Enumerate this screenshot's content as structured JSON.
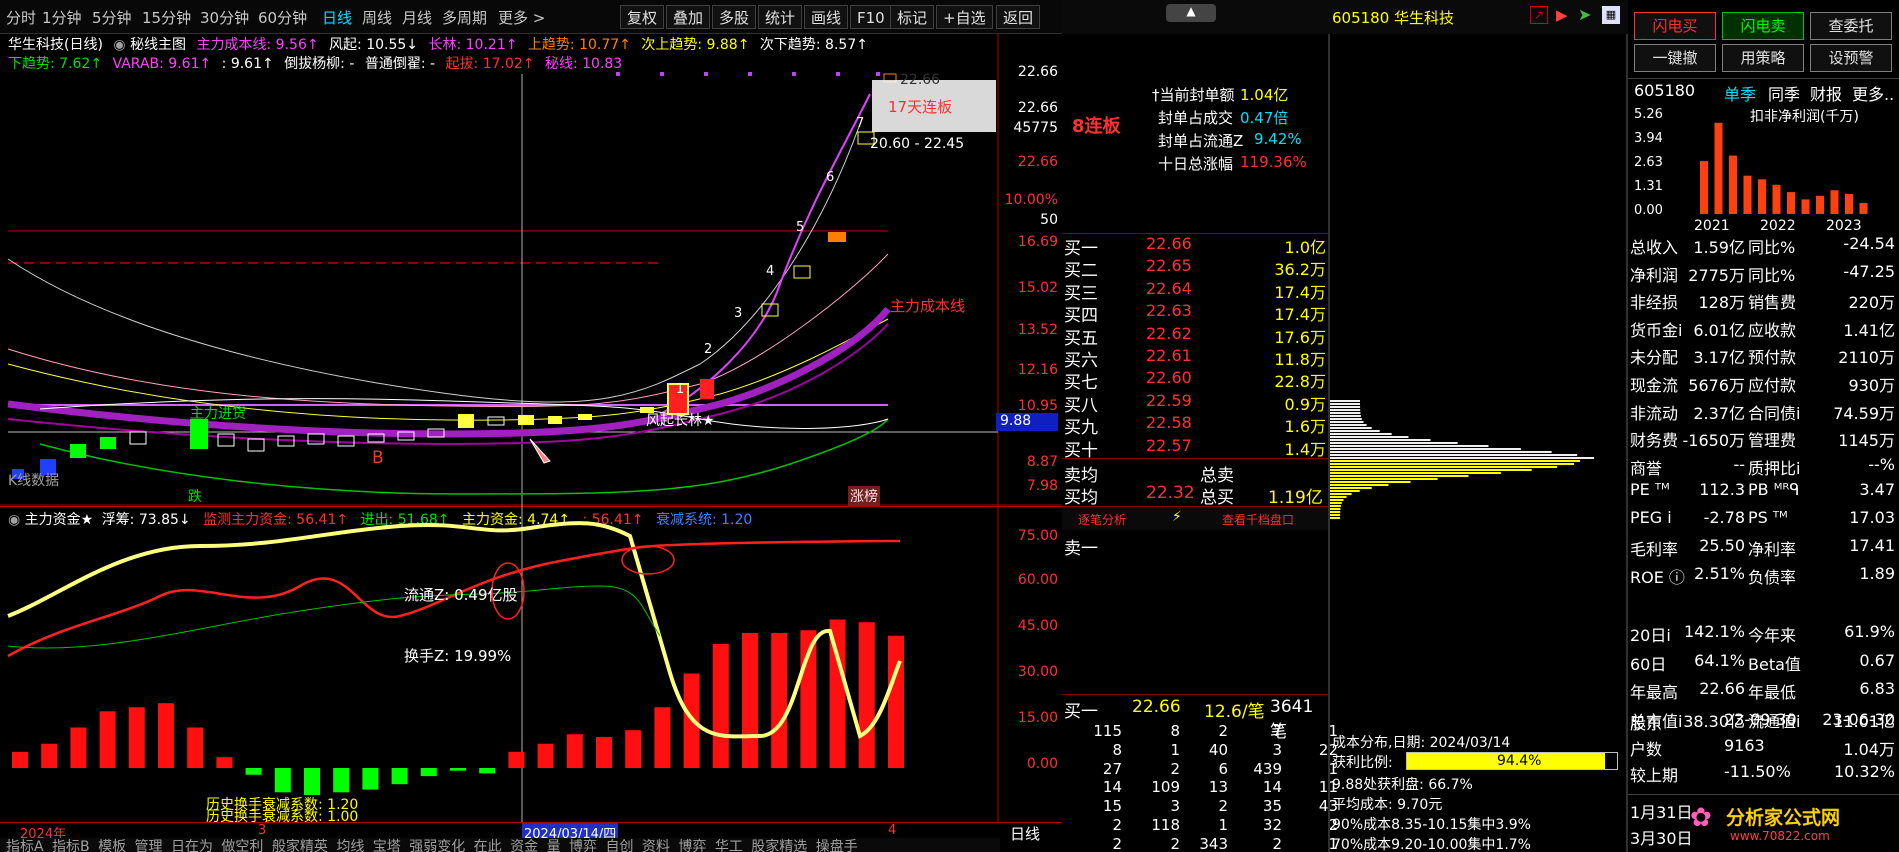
{
  "period_tabs": [
    "分时",
    "1分钟",
    "5分钟",
    "15分钟",
    "30分钟",
    "60分钟",
    "日线",
    "周线",
    "月线",
    "多周期",
    "更多 >"
  ],
  "toolbar": [
    "复权",
    "叠加",
    "多股",
    "统计",
    "画线",
    "F10",
    "标记",
    "+自选",
    "返回"
  ],
  "chart_title": {
    "name": "华生科技(日线)",
    "main": "秘线主图",
    "zlcbx": "主力成本线: 9.56↑",
    "fengqi": "风起: 10.55↓",
    "changlin": "长林: 10.21↑",
    "shangqs": "上趋势: 10.77↑",
    "ciqs": "次上趋势: 9.88↑",
    "cixqs": "次下趋势: 8.57↑"
  },
  "chart_title2": {
    "xqs": "下趋势: 7.62↑",
    "varab": "VARAB: 9.61↑",
    "v2": ": 9.61↑",
    "daobei": "倒拔杨柳: -",
    "putong": "普通倒翟: -",
    "qiba": "起拔: 17.02↑",
    "milin": "秘线: 10.83"
  },
  "price_axis": [
    "22.66",
    "45775",
    "22.66",
    "10.00%",
    "50",
    "16.69",
    "15.02",
    "13.52",
    "12.16",
    "10.95",
    "9.88",
    "8.87",
    "7.98"
  ],
  "annot": {
    "lianban": "17天连板",
    "range": "20.60 - 22.45",
    "zlcbx": "主力成本线",
    "zlcx": "主力进货",
    "fqcl": "风起长林★",
    "B": "B",
    "die": "跌",
    "zhangbang": "涨榜",
    "xdata": "K线数据",
    "c1": "1",
    "c2": "2",
    "c3": "3",
    "c4": "4",
    "c5": "5",
    "c6": "6",
    "c7": "7",
    "p1": "22.66"
  },
  "sub_title": {
    "name": "主力资金★",
    "fuchou": "浮筹: 73.85↓",
    "jiance": "监测主力资金: 56.41↑",
    "jinchu": "进出: 51.68↑",
    "zlzj": "主力资金: 4.74↑",
    "v2": ": 56.41↑",
    "sjxt": "衰减系统: 1.20"
  },
  "sub_axis": [
    "75.00",
    "60.00",
    "45.00",
    "30.00",
    "15.00",
    "0.00"
  ],
  "sub_annot": {
    "liutong": "流通Z: 0.49亿股",
    "huanshou": "换手Z: 19.99%",
    "hist1": "历史换手衰减系数: 1.20",
    "hist2": "历史换手衰减系数: 1.00"
  },
  "date_axis": {
    "d1": "2024年",
    "d2": "3",
    "d3": "2024/03/14/四",
    "d4": "4",
    "period": "日线"
  },
  "bottom_tabs": [
    "指标A",
    "指标B",
    "模板",
    "管理",
    "日在为",
    "做空利",
    "般家精英",
    "均线",
    "宝塔",
    "强弱变化",
    "在此",
    "资金",
    "量",
    "博弈",
    "自创",
    "资料",
    "博弈",
    "华工",
    "股家精选",
    "操盘手"
  ],
  "seal": {
    "title": "8连板",
    "r1l": "当前封单额",
    "r1v": "1.04亿",
    "r2l": "封单占成交",
    "r2v": "0.47倍",
    "r3l": "封单占流通Z",
    "r3v": "9.42%",
    "r4l": "十日总涨幅",
    "r4v": "119.36%"
  },
  "bids": [
    [
      "买一",
      "22.66",
      "1.0亿"
    ],
    [
      "买二",
      "22.65",
      "36.2万"
    ],
    [
      "买三",
      "22.64",
      "17.4万"
    ],
    [
      "买四",
      "22.63",
      "17.4万"
    ],
    [
      "买五",
      "22.62",
      "17.6万"
    ],
    [
      "买六",
      "22.61",
      "11.8万"
    ],
    [
      "买七",
      "22.60",
      "22.8万"
    ],
    [
      "买八",
      "22.59",
      "0.9万"
    ],
    [
      "买九",
      "22.58",
      "1.6万"
    ],
    [
      "买十",
      "22.57",
      "1.4万"
    ]
  ],
  "avg": {
    "maijun": "卖均",
    "zongmai": "总卖",
    "maijun2": "买均",
    "mjv": "22.32",
    "zongmai2": "总买",
    "zmv": "1.19亿"
  },
  "subtabs": {
    "a": "逐笔分析",
    "b": "⚡",
    "c": "查看千档盘口"
  },
  "sell1": "卖一",
  "trade_head": {
    "l": "买一",
    "p": "22.66",
    "v": "12.6/笔",
    "n": "3641笔"
  },
  "trades": [
    [
      "115",
      "8",
      "2",
      "7",
      "1"
    ],
    [
      "8",
      "1",
      "40",
      "3",
      "22"
    ],
    [
      "27",
      "2",
      "6",
      "439",
      "1"
    ],
    [
      "14",
      "109",
      "13",
      "14",
      "11"
    ],
    [
      "15",
      "3",
      "2",
      "35",
      "43"
    ],
    [
      "2",
      "118",
      "1",
      "32",
      "2"
    ],
    [
      "2",
      "2",
      "343",
      "2",
      "1"
    ]
  ],
  "stock_top": {
    "code_name": "605180 华生科技"
  },
  "cost": {
    "title": "成本分布,日期: 2024/03/14",
    "ratio_l": "获利比例:",
    "ratio_v": "94.4%",
    "l1": "9.88处获利盘: 66.7%",
    "l2": "平均成本: 9.70元",
    "l3": "90%成本8.35-10.15集中3.9%",
    "l4": "70%成本9.20-10.00集中1.7%",
    "price": "9.88"
  },
  "buttons": [
    "闪电买",
    "闪电卖",
    "查委托",
    "一键撤",
    "用策略",
    "设预警"
  ],
  "fin_header": {
    "code": "605180",
    "t1": "单季",
    "t2": "同季",
    "t3": "财报",
    "t4": "更多..",
    "chart_title": "扣非净利润(千万)"
  },
  "fin_chart": {
    "type": "bar",
    "categories": [
      "2021",
      "2022",
      "2023"
    ],
    "ylabels": [
      "5.26",
      "3.94",
      "2.63",
      "1.31",
      "0.00"
    ],
    "values": [
      2.9,
      5.0,
      3.2,
      2.1,
      1.9,
      1.6,
      1.2,
      0.8,
      1.0,
      1.3,
      1.1,
      0.6
    ],
    "ylim": [
      0,
      5.26
    ]
  },
  "fin_rows": [
    [
      "总收入",
      "1.59亿",
      "同比%",
      "-24.54"
    ],
    [
      "净利润",
      "2775万",
      "同比%",
      "-47.25"
    ],
    [
      "非经损",
      "128万",
      "销售费",
      "220万"
    ],
    [
      "货币金i",
      "6.01亿",
      "应收款",
      "1.41亿"
    ],
    [
      "未分配",
      "3.17亿",
      "预付款",
      "2110万"
    ],
    [
      "现金流",
      "5676万",
      "应付款",
      "930万"
    ],
    [
      "非流动",
      "2.37亿",
      "合同债i",
      "74.59万"
    ],
    [
      "财务费",
      "-1650万",
      "管理费",
      "1145万"
    ],
    [
      "商誉",
      "--",
      "质押比i",
      "--%"
    ]
  ],
  "fin_rows2": [
    [
      "PE ᵀᴹ",
      "112.3",
      "PB ᴹᴿᑫ",
      "3.47"
    ],
    [
      "PEG i",
      "-2.78",
      "PS ᵀᴹ",
      "17.03"
    ],
    [
      "毛利率",
      "25.50",
      "净利率",
      "17.41"
    ],
    [
      "ROE ⓘ",
      "2.51%",
      "负债率",
      "1.89"
    ]
  ],
  "fin_rows3": [
    [
      "20日i",
      "142.1%",
      "今年来",
      "61.9%"
    ],
    [
      "60日",
      "64.1%",
      "Beta值",
      "0.67"
    ],
    [
      "年最高",
      "22.66",
      "年最低",
      "6.83"
    ],
    [
      "总市值i",
      "38.30亿",
      "流通值i",
      "11.01亿"
    ]
  ],
  "holders": [
    [
      "股东",
      "23-09-30",
      "23-06-30"
    ],
    [
      "户数",
      "9163",
      "1.04万"
    ],
    [
      "较上期",
      "-11.50%",
      "10.32%"
    ]
  ],
  "dates": [
    "1月31日",
    "3月30日"
  ],
  "logo": {
    "name": "分析家公式网",
    "url": "www.70822.com"
  }
}
